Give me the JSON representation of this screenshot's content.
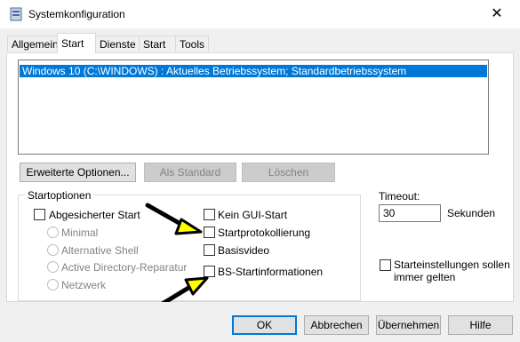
{
  "window": {
    "title": "Systemkonfiguration",
    "close_glyph": "✕"
  },
  "tabs": [
    "Allgemein",
    "Start",
    "Dienste",
    "Start",
    "Tools"
  ],
  "boot_list": {
    "items": [
      "Windows 10 (C:\\WINDOWS) : Aktuelles Betriebssystem; Standardbetriebssystem"
    ]
  },
  "buttons": {
    "advanced": "Erweiterte Optionen...",
    "set_default": "Als Standard",
    "delete": "Löschen"
  },
  "boot_options": {
    "legend": "Startoptionen",
    "safe_boot": "Abgesicherter Start",
    "radios": [
      "Minimal",
      "Alternative Shell",
      "Active Directory-Reparatur",
      "Netzwerk"
    ],
    "no_gui": "Kein GUI-Start",
    "boot_log": "Startprotokollierung",
    "base_video": "Basisvideo",
    "os_boot_info": "BS-Startinformationen"
  },
  "timeout": {
    "label": "Timeout:",
    "value": "30",
    "unit": "Sekunden"
  },
  "permanent": {
    "line1": "Starteinstellungen sollen",
    "line2": "immer gelten"
  },
  "footer": {
    "ok": "OK",
    "cancel": "Abbrechen",
    "apply": "Übernehmen",
    "help": "Hilfe"
  },
  "colors": {
    "selection": "#0078d7",
    "accent_border": "#0078d7",
    "annotation_arrow": "#ffff00"
  }
}
